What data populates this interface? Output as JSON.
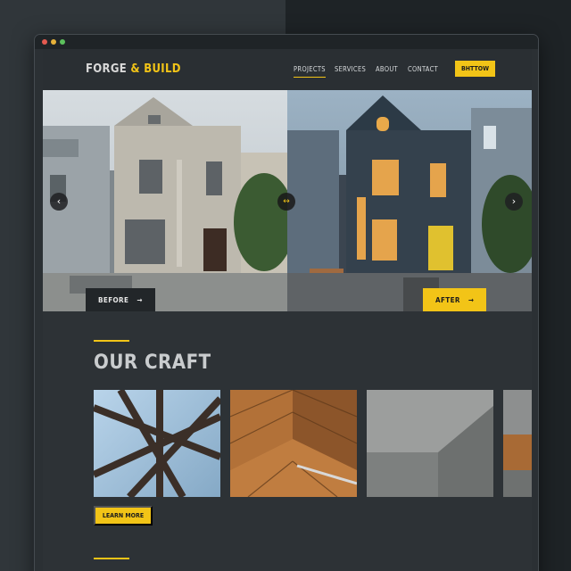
{
  "window": {
    "controls": [
      "close",
      "minimize",
      "maximize"
    ],
    "control_colors": [
      "#e45a50",
      "#e6b13a",
      "#5cc15d"
    ]
  },
  "header": {
    "logo": {
      "part1": "FORGE",
      "amp": "&",
      "part2": "BUILD"
    },
    "nav": [
      {
        "label": "PROJECTS",
        "active": true
      },
      {
        "label": "SERVICES",
        "active": false
      },
      {
        "label": "ABOUT",
        "active": false
      },
      {
        "label": "CONTACT",
        "active": false
      }
    ],
    "cta_label": "BHTTOW"
  },
  "hero": {
    "before_label": "BEFORE",
    "after_label": "AFTER",
    "prev_icon": "chevron-left-icon",
    "next_icon": "chevron-right-icon",
    "handle_icon": "compare-arrows-icon"
  },
  "craft": {
    "title": "OUR CRAFT",
    "tiles": [
      "steel-frame-image",
      "wood-chevron-image",
      "concrete-image",
      "wood-concrete-image"
    ],
    "button_label": "LEARN MORE"
  },
  "colors": {
    "accent": "#f2c417",
    "background": "#2d3236",
    "header_bg": "#2a2f33",
    "text_light": "#d7dadc",
    "dark_button": "#222629"
  }
}
